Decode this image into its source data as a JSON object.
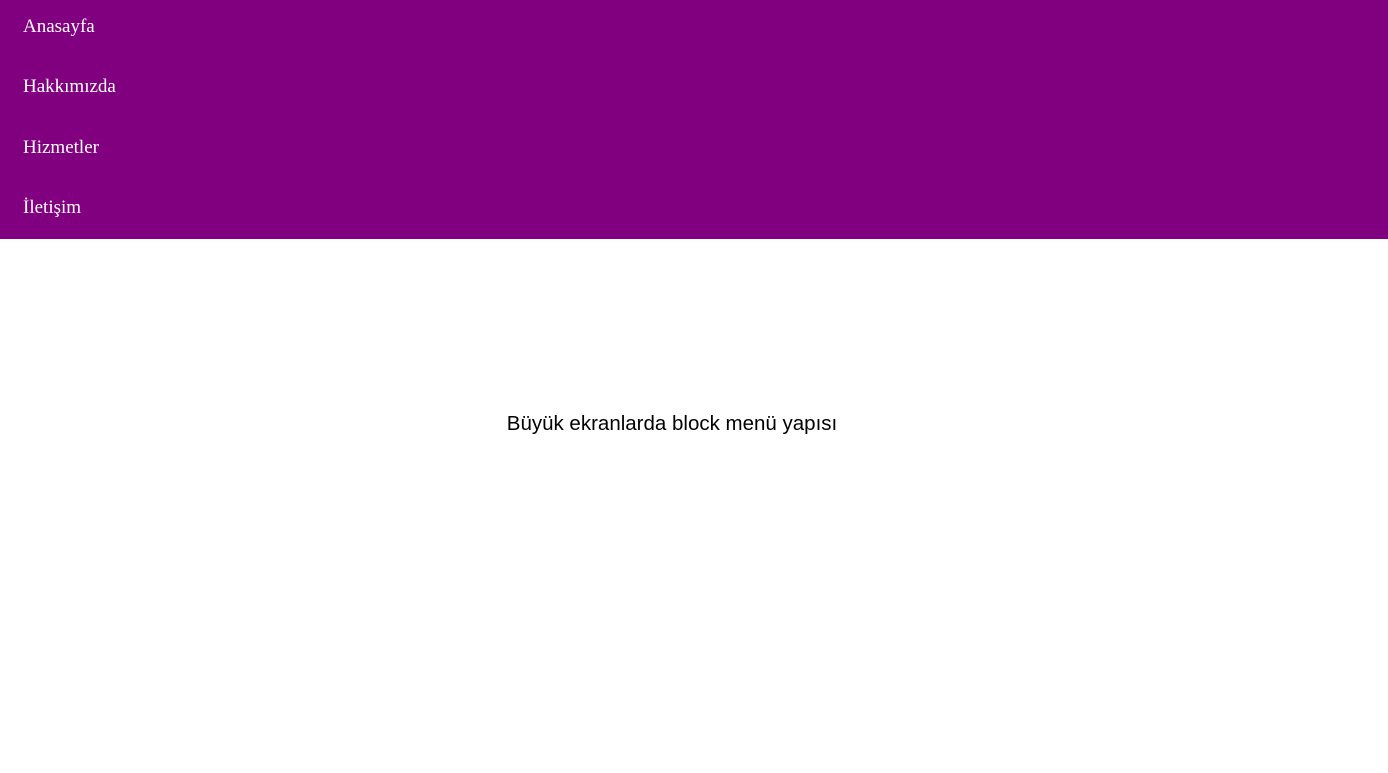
{
  "menu": {
    "background_color": "#800080",
    "text_color": "#ffffff",
    "items": [
      {
        "label": "Anasayfa"
      },
      {
        "label": "Hakkımızda"
      },
      {
        "label": "Hizmetler"
      },
      {
        "label": "İletişim"
      }
    ]
  },
  "content": {
    "caption": "Büyük ekranlarda block menü yapısı"
  }
}
